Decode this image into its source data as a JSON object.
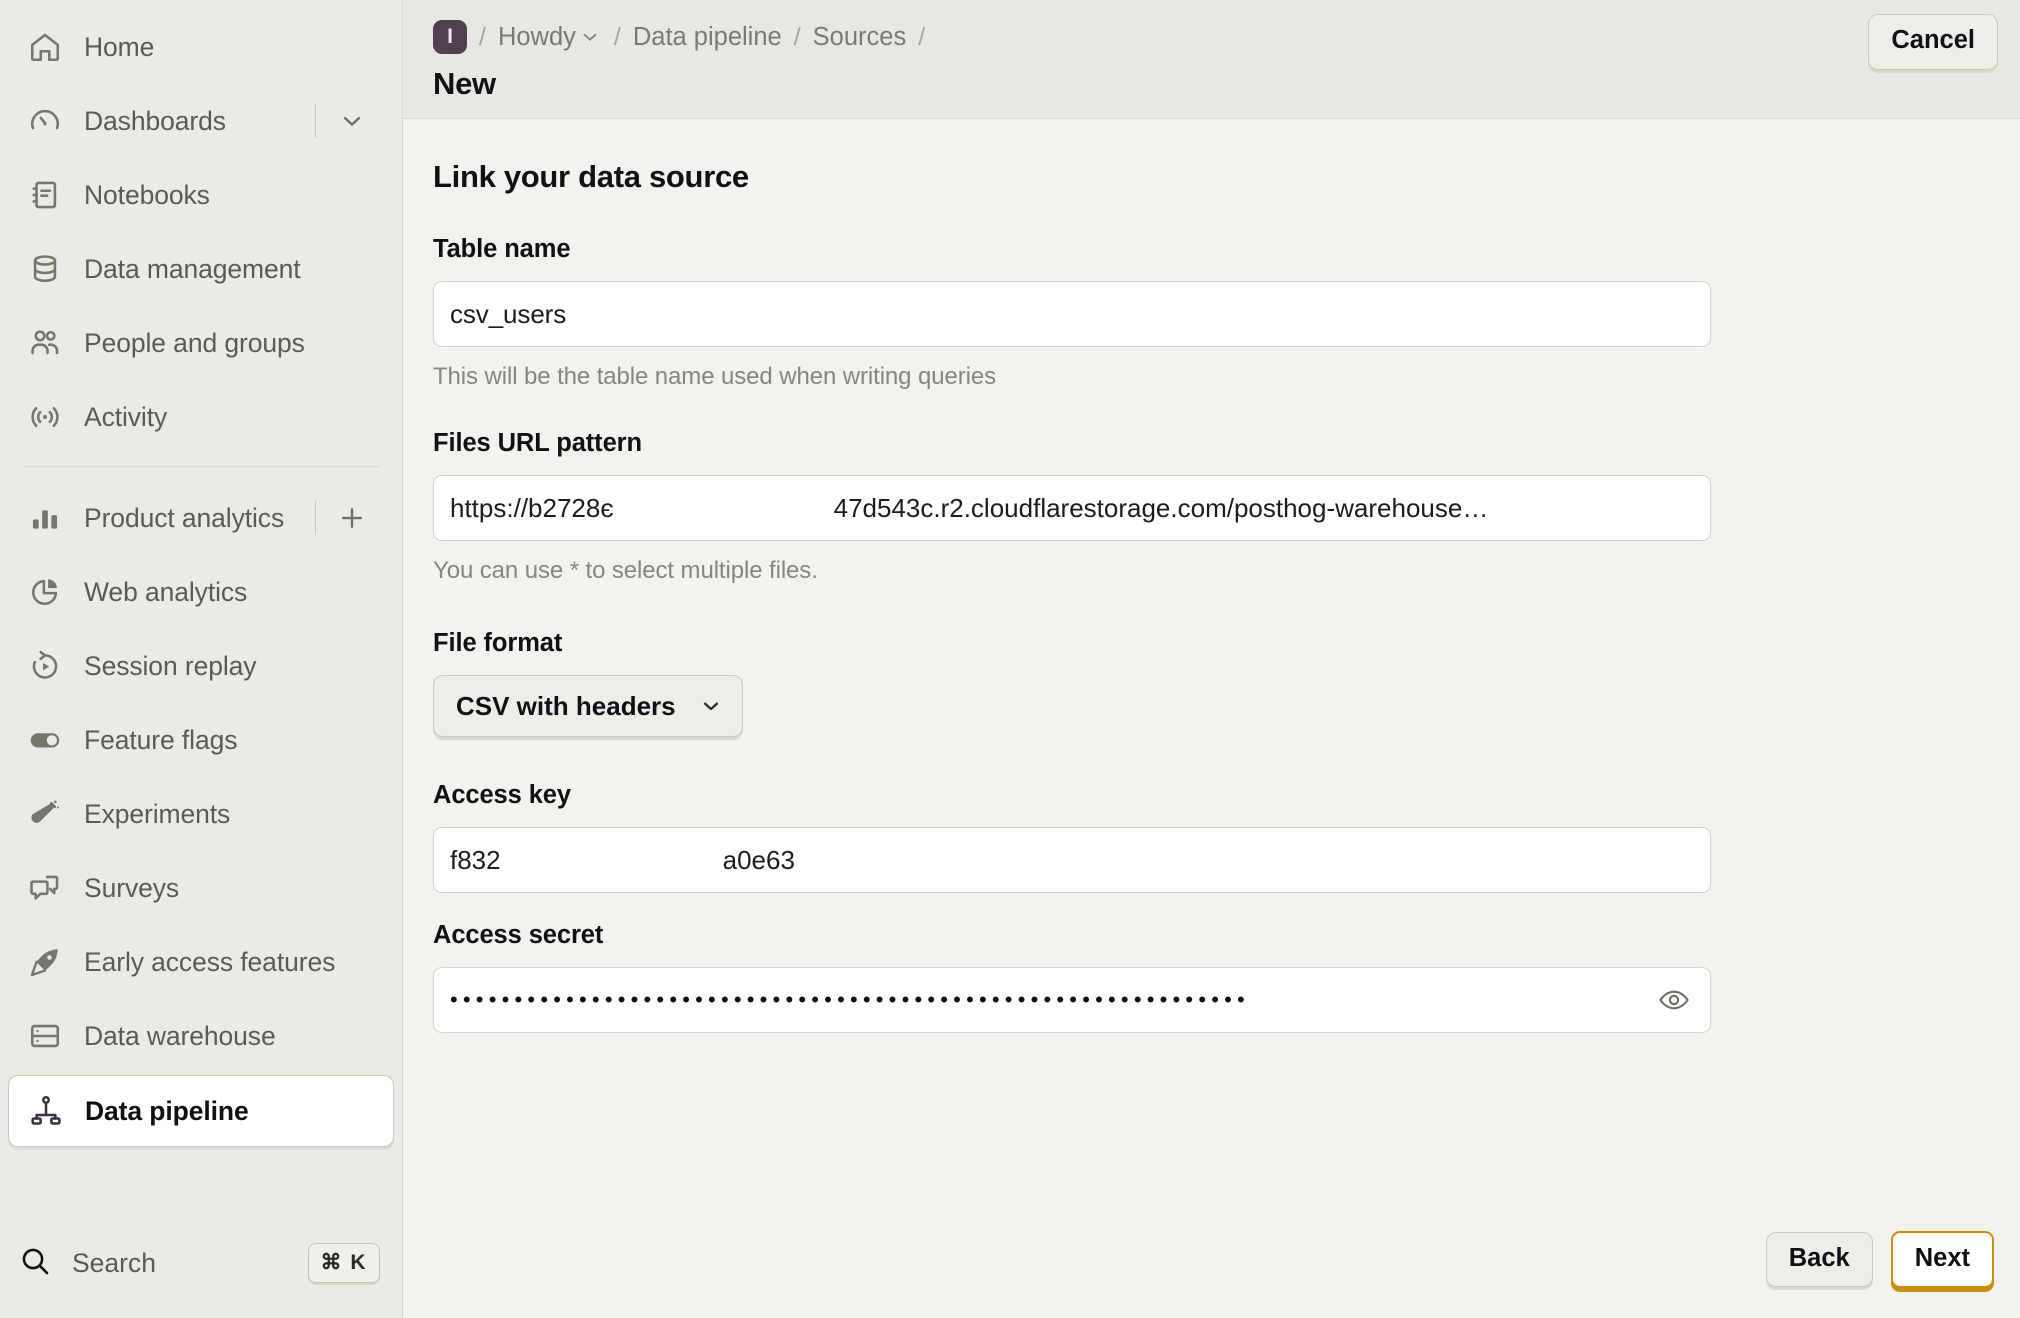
{
  "sidebar": {
    "primary_items": [
      {
        "label": "Home",
        "icon": "home-icon"
      },
      {
        "label": "Dashboards",
        "icon": "dashboard-gauge-icon",
        "trailing": "chevron-down-icon"
      },
      {
        "label": "Notebooks",
        "icon": "notebook-icon"
      },
      {
        "label": "Data management",
        "icon": "database-icon"
      },
      {
        "label": "People and groups",
        "icon": "people-icon"
      },
      {
        "label": "Activity",
        "icon": "activity-broadcast-icon"
      }
    ],
    "secondary_items": [
      {
        "label": "Product analytics",
        "icon": "bar-chart-icon",
        "trailing": "plus-icon"
      },
      {
        "label": "Web analytics",
        "icon": "pie-chart-icon"
      },
      {
        "label": "Session replay",
        "icon": "replay-play-icon"
      },
      {
        "label": "Feature flags",
        "icon": "toggle-icon"
      },
      {
        "label": "Experiments",
        "icon": "flask-icon"
      },
      {
        "label": "Surveys",
        "icon": "speech-bubbles-icon"
      },
      {
        "label": "Early access features",
        "icon": "rocket-icon"
      },
      {
        "label": "Data warehouse",
        "icon": "server-rack-icon"
      },
      {
        "label": "Data pipeline",
        "icon": "pipeline-nodes-icon",
        "active": true
      }
    ],
    "search": {
      "label": "Search",
      "icon": "search-icon",
      "shortcut": "⌘ K"
    }
  },
  "topbar": {
    "project_badge": "I",
    "separator": "/",
    "breadcrumbs": [
      {
        "label": "Howdy",
        "has_chevron": true
      },
      {
        "label": "Data pipeline",
        "has_chevron": false
      },
      {
        "label": "Sources",
        "has_chevron": false
      }
    ],
    "page_title": "New",
    "cancel_label": "Cancel"
  },
  "form": {
    "heading": "Link your data source",
    "table_name": {
      "label": "Table name",
      "value": "csv_users",
      "placeholder": "Table name",
      "hint": "This will be the table name used when writing queries"
    },
    "files_url_pattern": {
      "label": "Files URL pattern",
      "value_prefix": "https://b2728є",
      "value_suffix": "47d543c.r2.cloudflarestorage.com/posthog-warehouse…",
      "placeholder": "Files URL pattern",
      "hint": "You can use * to select multiple files."
    },
    "file_format": {
      "label": "File format",
      "selected": "CSV with headers",
      "chevron_icon": "chevron-down-icon"
    },
    "access_key": {
      "label": "Access key",
      "value_prefix": "f832",
      "value_suffix": "a0e63",
      "placeholder": "Access key"
    },
    "access_secret": {
      "label": "Access secret",
      "value": "••••••••••••••••••••••••••••••••••••••••••••••••••••••••••••••",
      "placeholder": "Access secret",
      "reveal_icon": "eye-icon"
    }
  },
  "footer": {
    "back_label": "Back",
    "next_label": "Next"
  },
  "colors": {
    "sidebar_bg": "#ebebe5",
    "topbar_bg": "#e8e8e2",
    "content_bg": "#f2f2ee",
    "badge": "#4f414f",
    "next_accent": "#c98e12",
    "text": "#111014",
    "muted": "#7a7a72"
  }
}
